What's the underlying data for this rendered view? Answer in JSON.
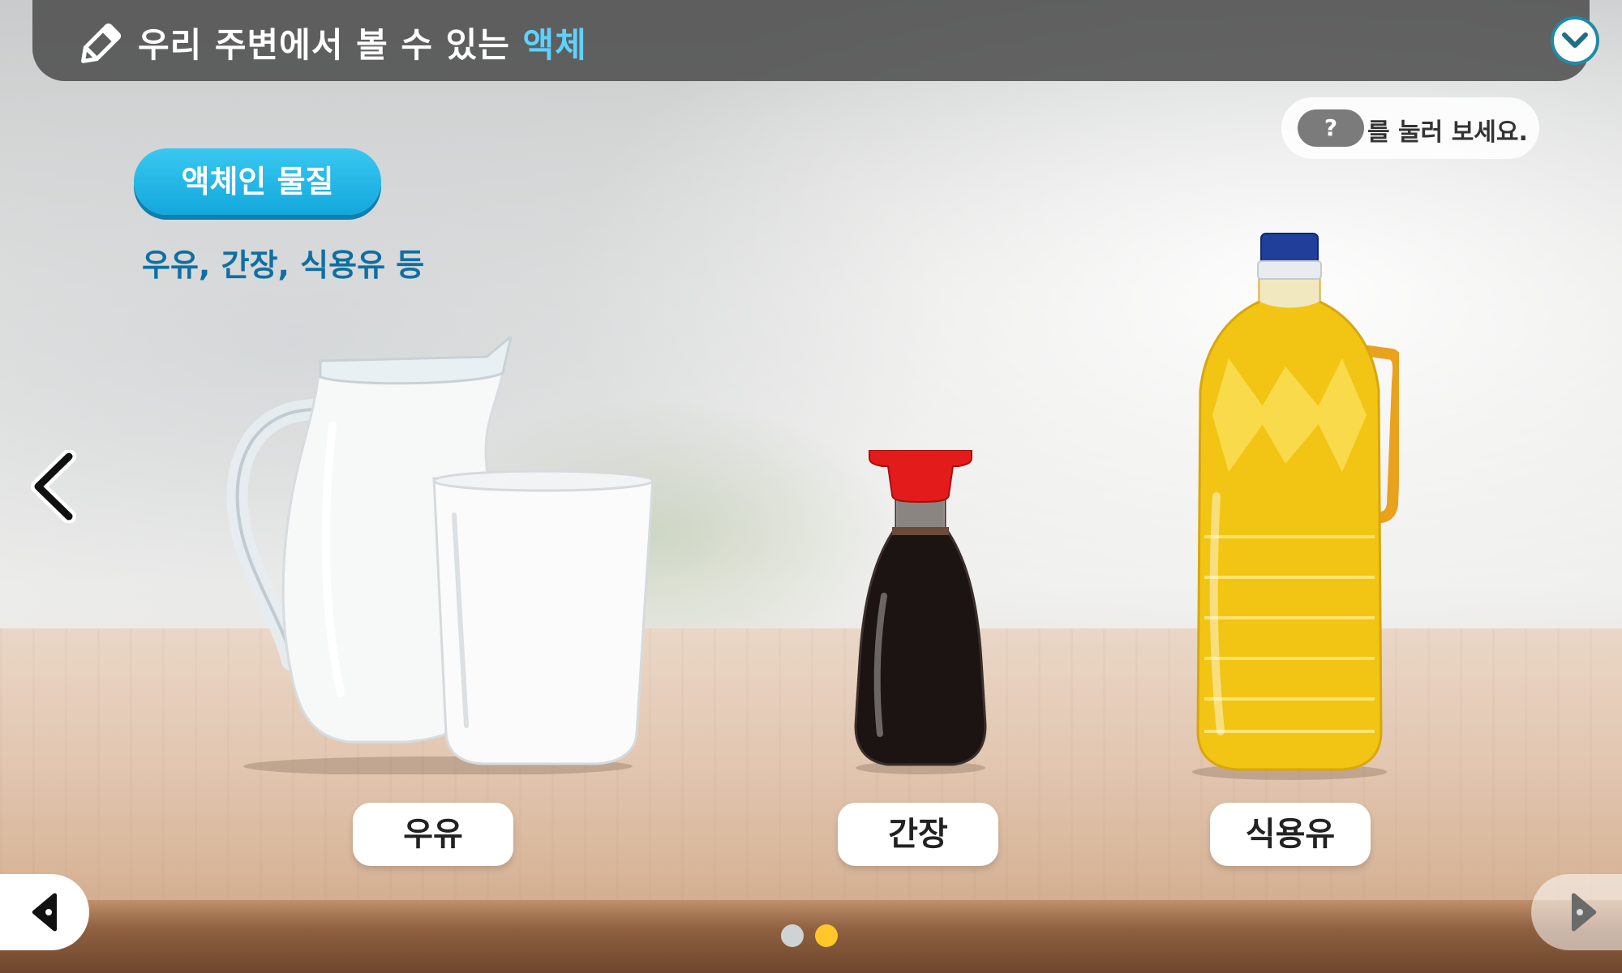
{
  "header": {
    "title_prefix": "우리 주변에서 볼 수 있는 ",
    "title_highlight": "액체"
  },
  "hint": {
    "button_label": "?",
    "text": "를 눌러 보세요."
  },
  "category": {
    "label": "액체인 물질",
    "examples": "우유, 간장, 식용유 등"
  },
  "items": [
    {
      "label": "우유"
    },
    {
      "label": "간장"
    },
    {
      "label": "식용유"
    }
  ],
  "pagination": {
    "total": 2,
    "current": 2
  },
  "colors": {
    "accent": "#5fd1ff",
    "category_button": "#13a7dc",
    "examples_text": "#0f6fa1",
    "active_dot": "#ffc729",
    "inactive_dot": "#cfd3d6"
  }
}
